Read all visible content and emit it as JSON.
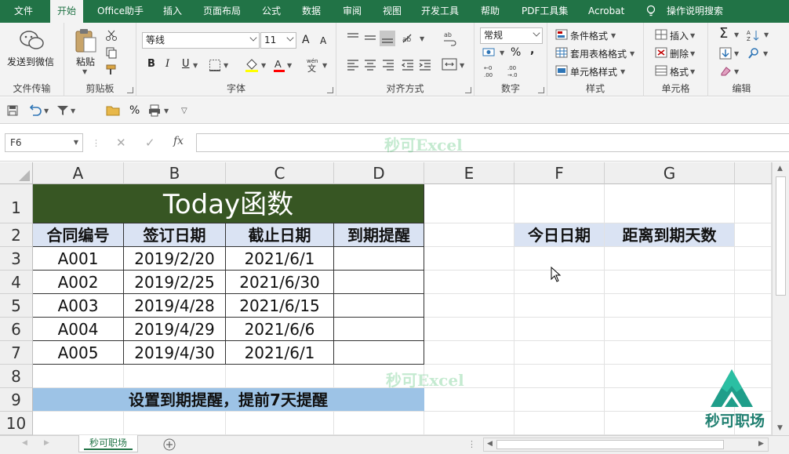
{
  "menu": {
    "tabs": [
      "文件",
      "开始",
      "Office助手",
      "插入",
      "页面布局",
      "公式",
      "数据",
      "审阅",
      "视图",
      "开发工具",
      "帮助",
      "PDF工具集",
      "Acrobat"
    ],
    "active_index": 1,
    "tell_me": "操作说明搜索"
  },
  "ribbon": {
    "share": {
      "label": "发送到微信",
      "group": "文件传输"
    },
    "clipboard": {
      "paste": "粘贴",
      "group": "剪贴板"
    },
    "font": {
      "name": "等线",
      "size": "11",
      "bold": "B",
      "italic": "I",
      "underline": "U",
      "grow": "A",
      "shrink": "A",
      "group": "字体"
    },
    "align": {
      "group": "对齐方式"
    },
    "number": {
      "format": "常规",
      "percent": "%",
      "comma": ",",
      "group": "数字"
    },
    "styles": {
      "conditional": "条件格式",
      "table": "套用表格格式",
      "cell": "单元格样式",
      "group": "样式"
    },
    "cells": {
      "insert": "插入",
      "delete": "删除",
      "format": "格式",
      "group": "单元格"
    },
    "editing": {
      "group": "编辑"
    }
  },
  "qat": {
    "percent": "%"
  },
  "formula_bar": {
    "cell_ref": "F6",
    "fx": "fx",
    "content": ""
  },
  "watermark": "秒可Excel",
  "columns": [
    "A",
    "B",
    "C",
    "D",
    "E",
    "F",
    "G"
  ],
  "rows": [
    "1",
    "2",
    "3",
    "4",
    "5",
    "6",
    "7",
    "8",
    "9",
    "10"
  ],
  "sheet": {
    "title": "Today函数",
    "headers": [
      "合同编号",
      "签订日期",
      "截止日期",
      "到期提醒"
    ],
    "records": [
      [
        "A001",
        "2019/2/20",
        "2021/6/1",
        ""
      ],
      [
        "A002",
        "2019/2/25",
        "2021/6/30",
        ""
      ],
      [
        "A003",
        "2019/4/28",
        "2021/6/15",
        ""
      ],
      [
        "A004",
        "2019/4/29",
        "2021/6/6",
        ""
      ],
      [
        "A005",
        "2019/4/30",
        "2021/6/1",
        ""
      ]
    ],
    "today_label": "今日日期",
    "days_label": "距离到期天数",
    "note": "设置到期提醒，提前7天提醒"
  },
  "logo": {
    "text": "秒可职场"
  },
  "sheet_tabs": [
    "秒可职场"
  ],
  "colors": {
    "excel_green": "#217346",
    "title_fill": "#375623",
    "header_fill": "#dae3f3",
    "note_fill": "#9dc3e6"
  }
}
